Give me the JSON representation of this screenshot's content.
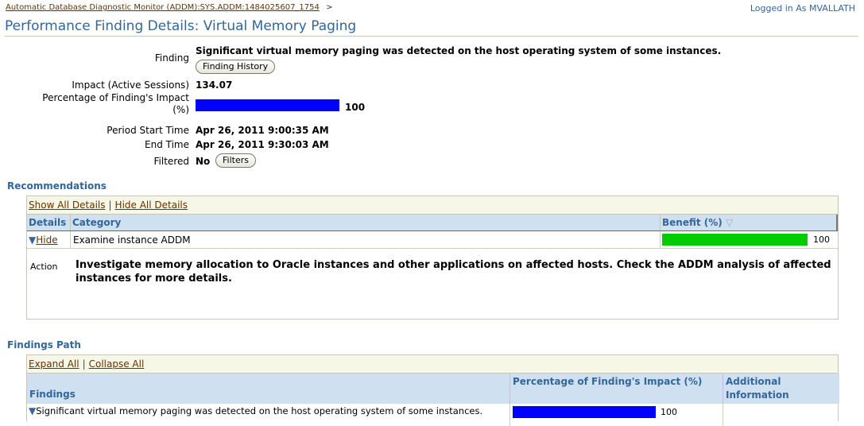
{
  "breadcrumb": {
    "link": "Automatic Database Diagnostic Monitor (ADDM):SYS.ADDM:1484025607_1754",
    "separator": ">"
  },
  "login_text": "Logged in As MVALLATH",
  "page_title": "Performance Finding Details: Virtual Memory Paging",
  "details": {
    "finding_label": "Finding",
    "finding_value": "Significant virtual memory paging was detected on the host operating system of some instances.",
    "finding_history_button": "Finding History",
    "impact_label": "Impact (Active Sessions)",
    "impact_value": "134.07",
    "pct_label_1": "Percentage of Finding's Impact",
    "pct_label_2": "(%)",
    "pct_value": "100",
    "pct_fraction": 1.0,
    "start_label": "Period Start Time",
    "start_value": "Apr 26, 2011 9:00:35 AM",
    "end_label": "End Time",
    "end_value": "Apr 26, 2011 9:30:03 AM",
    "filtered_label": "Filtered",
    "filtered_value": "No",
    "filters_button": "Filters"
  },
  "recommendations": {
    "title": "Recommendations",
    "show_all": "Show All Details",
    "hide_all": "Hide All Details",
    "divider": "|",
    "col_details": "Details",
    "col_category": "Category",
    "col_benefit": "Benefit (%)",
    "sort_icon": "▽",
    "row": {
      "toggle": "Hide",
      "category": "Examine instance ADDM",
      "benefit": "100",
      "benefit_fraction": 1.0
    },
    "action_label": "Action",
    "action_text": "Investigate memory allocation to Oracle instances and other applications on affected hosts. Check the ADDM analysis of affected instances for more details."
  },
  "findings_path": {
    "title": "Findings Path",
    "expand_all": "Expand All",
    "collapse_all": "Collapse All",
    "divider": "|",
    "col_findings": "Findings",
    "col_pct": "Percentage of Finding's Impact (%)",
    "col_info": "Additional Information",
    "row": {
      "text": "Significant virtual memory paging was detected on the host operating system of some instances.",
      "pct": "100",
      "pct_fraction": 1.0
    }
  },
  "colors": {
    "blue_bar": "#0000ff",
    "green_bar": "#00cc00",
    "header_blue": "#336699"
  }
}
